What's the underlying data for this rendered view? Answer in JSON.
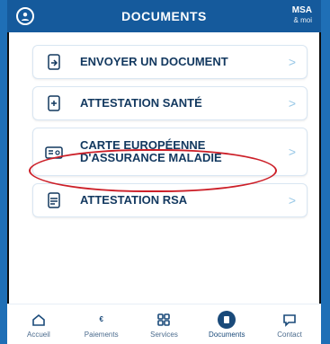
{
  "header": {
    "title": "DOCUMENTS",
    "logo_main": "MSA",
    "logo_sub": "& moi"
  },
  "documents": [
    {
      "label": "ENVOYER UN DOCUMENT",
      "icon": "send-document-icon"
    },
    {
      "label": "ATTESTATION SANTÉ",
      "icon": "health-certificate-icon"
    },
    {
      "label": "CARTE EUROPÉENNE D'ASSURANCE MALADIE",
      "icon": "european-card-icon"
    },
    {
      "label": "ATTESTATION RSA",
      "icon": "rsa-certificate-icon"
    }
  ],
  "chevron": ">",
  "nav": [
    {
      "label": "Accueil",
      "icon": "home-icon"
    },
    {
      "label": "Paiements",
      "icon": "euro-icon"
    },
    {
      "label": "Services",
      "icon": "grid-icon"
    },
    {
      "label": "Documents",
      "icon": "documents-icon",
      "active": true
    },
    {
      "label": "Contact",
      "icon": "chat-icon"
    }
  ],
  "colors": {
    "header": "#155a9c",
    "text_primary": "#12385f",
    "highlight": "#cc1f28"
  }
}
